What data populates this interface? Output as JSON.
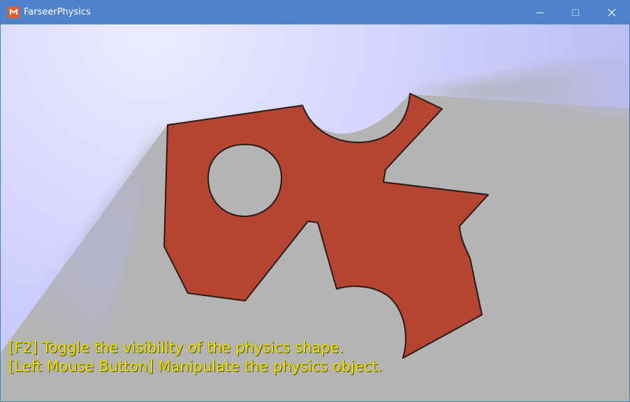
{
  "window": {
    "title": "FarseerPhysics",
    "icon": "monogame-logo-icon",
    "controls": {
      "minimize_icon": "minimize-icon",
      "maximize_icon": "maximize-icon",
      "close_icon": "close-icon"
    }
  },
  "scene": {
    "background_color": "#b4b4b4",
    "light_color": "#e6e6ff",
    "shadow_tint": "#b4b4ff",
    "body_color": "#b34532",
    "outline_color": "#2a1a14"
  },
  "hud": {
    "line1": "[F2] Toggle the visibility of the physics shape.",
    "line2": "[Left Mouse Button] Manipulate the physics object.",
    "text_color": "#f0e400"
  }
}
